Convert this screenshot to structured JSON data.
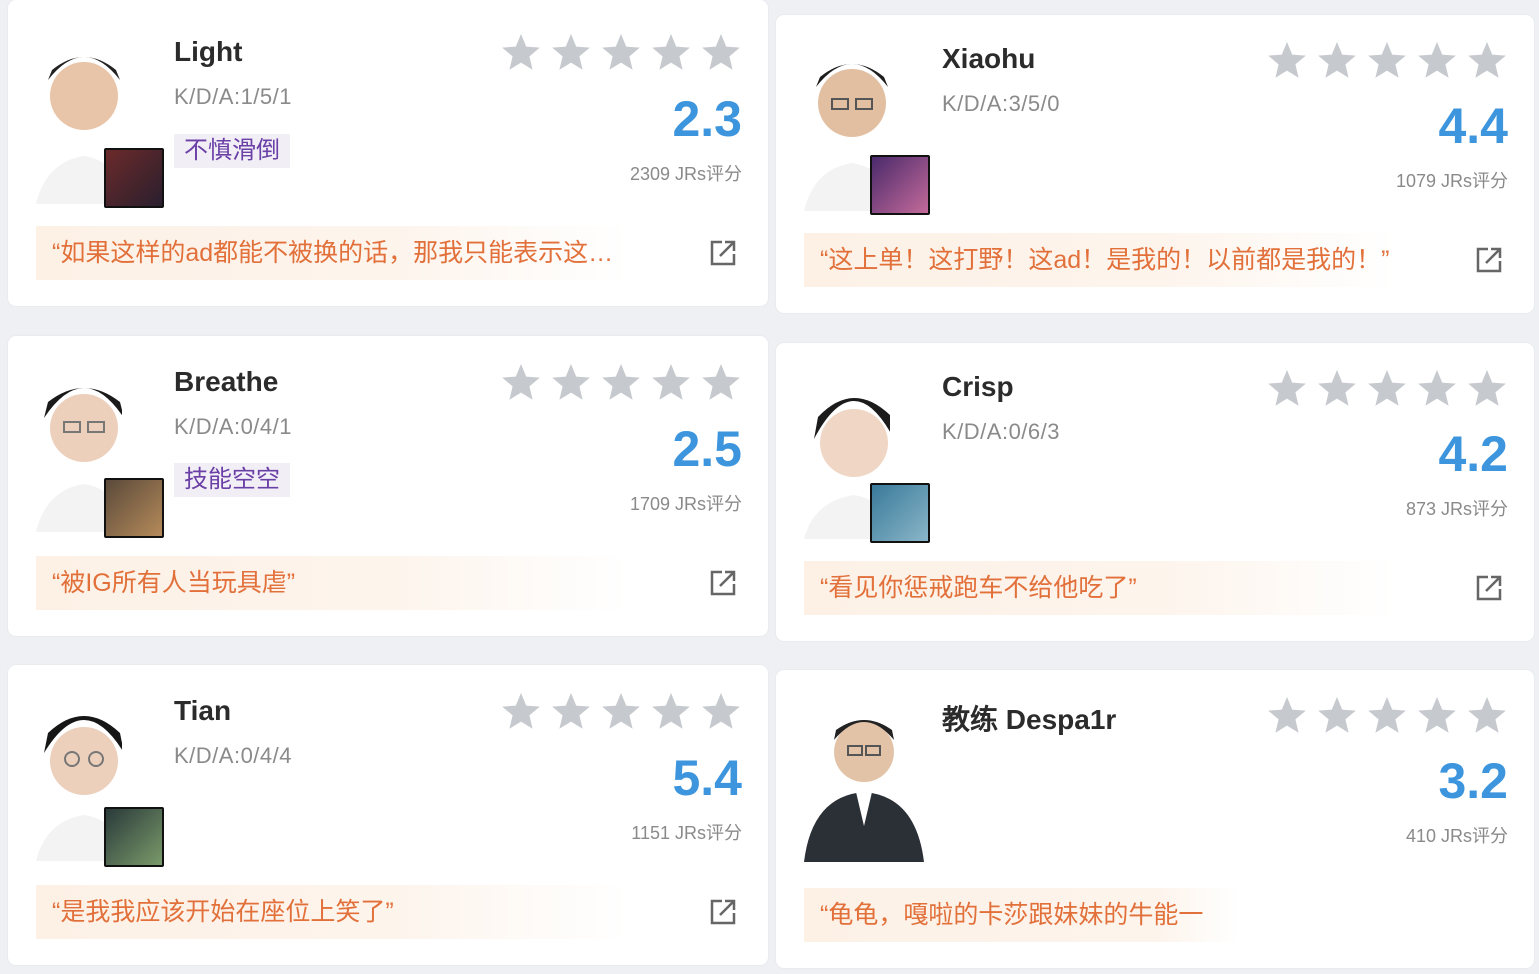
{
  "colors": {
    "score": "#3c95dd",
    "quote_text": "#e2703a",
    "quote_bg": "#fdf1e6",
    "tag_text": "#6a3fa6",
    "tag_bg": "#f1eef6",
    "star": "#c6c9ce"
  },
  "icons": {
    "rating": "star-icon",
    "share": "external-link-icon"
  },
  "players": [
    {
      "name": "Light",
      "kda": "K/D/A:1/5/1",
      "tag": "不慎滑倒",
      "stars": 0,
      "score": "2.3",
      "count": "2309 JRs评分",
      "quote": "“如果这样的ad都能不被换的话，那我只能表示这…"
    },
    {
      "name": "Xiaohu",
      "kda": "K/D/A:3/5/0",
      "tag": "",
      "stars": 0,
      "score": "4.4",
      "count": "1079 JRs评分",
      "quote": "“这上单！这打野！这ad！是我的！以前都是我的！”"
    },
    {
      "name": "Breathe",
      "kda": "K/D/A:0/4/1",
      "tag": "技能空空",
      "stars": 0,
      "score": "2.5",
      "count": "1709 JRs评分",
      "quote": "“被IG所有人当玩具虐”"
    },
    {
      "name": "Crisp",
      "kda": "K/D/A:0/6/3",
      "tag": "",
      "stars": 0,
      "score": "4.2",
      "count": "873 JRs评分",
      "quote": "“看见你惩戒跑车不给他吃了”"
    },
    {
      "name": "Tian",
      "kda": "K/D/A:0/4/4",
      "tag": "",
      "stars": 0,
      "score": "5.4",
      "count": "1151 JRs评分",
      "quote": "“是我我应该开始在座位上笑了”"
    },
    {
      "name": "教练 Despa1r",
      "kda": "",
      "tag": "",
      "stars": 0,
      "score": "3.2",
      "count": "410 JRs评分",
      "quote": "“龟龟，嘎啦的卡莎跟妹妹的牛能一"
    }
  ]
}
